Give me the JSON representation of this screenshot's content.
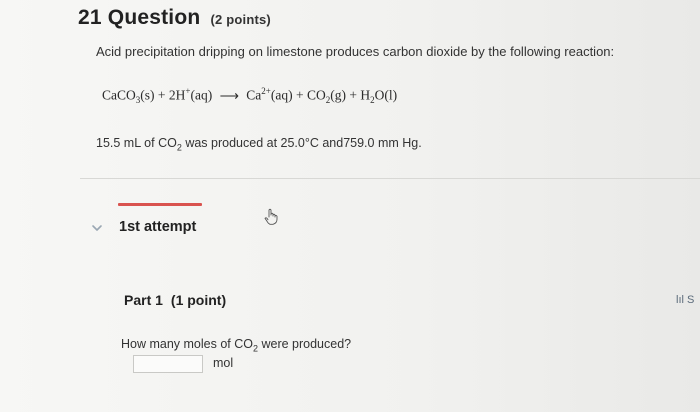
{
  "question": {
    "number_title": "21 Question",
    "points": "(2 points)",
    "prompt": "Acid precipitation dripping on limestone produces carbon dioxide by the following reaction:",
    "equation": {
      "r1": "CaCO",
      "r1_sub": "3",
      "r1_state": "(s)",
      "plus1": "+",
      "r2": "2H",
      "r2_sup": "+",
      "r2_state": "(aq)",
      "arrow": "⟶",
      "p1": "Ca",
      "p1_sup": "2+",
      "p1_state": "(aq)",
      "plus2": "+",
      "p2": "CO",
      "p2_sub": "2",
      "p2_state": "(g)",
      "plus3": "+",
      "p3a": "H",
      "p3_sub": "2",
      "p3b": "O",
      "p3_state": "(l)"
    },
    "conditions": {
      "before": "15.5 mL of CO",
      "sub": "2",
      "after": " was produced at 25.0°C and759.0 mm Hg."
    }
  },
  "attempt": {
    "label": "1st attempt",
    "accent_color": "#d9534f"
  },
  "part": {
    "title": "Part 1",
    "points": "(1 point)",
    "question_before": "How many moles of CO",
    "question_sub": "2",
    "question_after": " were produced?",
    "answer_value": "",
    "unit": "mol"
  },
  "side_tool": {
    "label": "lıl S",
    "icon": "bar-chart-icon"
  }
}
